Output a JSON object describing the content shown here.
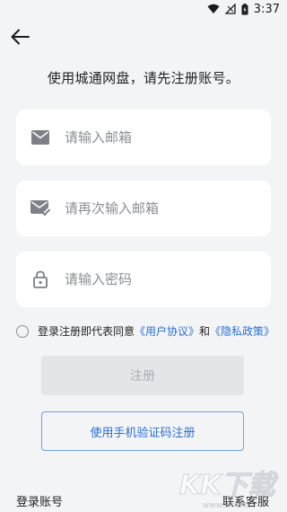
{
  "status_bar": {
    "time": "3:37",
    "icons": [
      "wifi-icon",
      "signal-icon",
      "battery-charging-icon"
    ]
  },
  "header": {
    "back_icon": "arrow-left-icon",
    "headline": "使用城通网盘，请先注册账号。"
  },
  "form": {
    "email": {
      "placeholder": "请输入邮箱",
      "icon": "mail-icon"
    },
    "email_confirm": {
      "placeholder": "请再次输入邮箱",
      "icon": "mail-check-icon"
    },
    "password": {
      "placeholder": "请输入密码",
      "icon": "lock-icon"
    }
  },
  "agreement": {
    "prefix": "登录注册即代表同意",
    "user_agreement": "《用户协议》",
    "conjunction": "和",
    "privacy_policy": "《隐私政策》"
  },
  "buttons": {
    "register": "注册",
    "sms_register": "使用手机验证码注册"
  },
  "footer": {
    "login_account": "登录账号",
    "contact_support": "联系客服"
  },
  "watermark": {
    "brand": "KK下载",
    "url": "www.kkx.net"
  },
  "colors": {
    "background": "#f3f4f6",
    "link": "#2a6fd6",
    "disabled_button": "#e3e5e9"
  }
}
